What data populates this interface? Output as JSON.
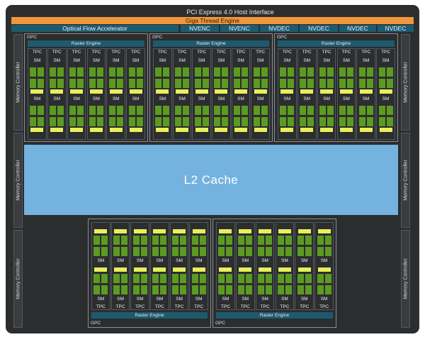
{
  "header": {
    "host_interface": "PCI Express 4.0 Host Interface",
    "giga_thread": "Giga Thread Engine",
    "optical_flow": "Optical Flow Accelerator",
    "codecs": [
      "NVENC",
      "NVENC",
      "NVDEC",
      "NVDEC",
      "NVDEC",
      "NVDEC"
    ]
  },
  "memory_controller": "Memory Controller",
  "l2_cache": "L2 Cache",
  "gpc": {
    "label": "GPC",
    "raster": "Raster Engine",
    "tpc": "TPC",
    "sm": "SM",
    "tpc_per_gpc": 6,
    "gpc_count": 5
  },
  "colors": {
    "chip_bg": "#2b2d2f",
    "giga_thread": "#f0963c",
    "fixed_function": "#1e5a6e",
    "l2_cache": "#74b2df",
    "sm_cores": "#5d9a21",
    "rt_cores": "#e8ef5a"
  }
}
